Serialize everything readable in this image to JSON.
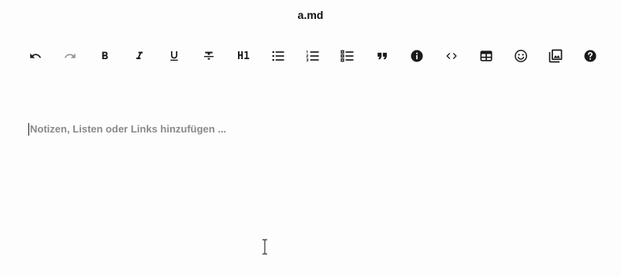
{
  "document": {
    "title": "a.md"
  },
  "toolbar": {
    "items": [
      {
        "name": "undo",
        "icon": "undo-icon",
        "enabled": true
      },
      {
        "name": "redo",
        "icon": "redo-icon",
        "enabled": false
      },
      {
        "name": "bold",
        "icon": "bold-icon",
        "enabled": true
      },
      {
        "name": "italic",
        "icon": "italic-icon",
        "enabled": true
      },
      {
        "name": "underline",
        "icon": "underline-icon",
        "enabled": true
      },
      {
        "name": "strikethrough",
        "icon": "strikethrough-icon",
        "enabled": true
      },
      {
        "name": "heading",
        "icon": "heading-icon",
        "label": "H1",
        "enabled": true
      },
      {
        "name": "bullet-list",
        "icon": "bullet-list-icon",
        "enabled": true
      },
      {
        "name": "ordered-list",
        "icon": "ordered-list-icon",
        "enabled": true
      },
      {
        "name": "checklist",
        "icon": "checklist-icon",
        "enabled": true
      },
      {
        "name": "blockquote",
        "icon": "quote-icon",
        "enabled": true
      },
      {
        "name": "info",
        "icon": "info-icon",
        "enabled": true
      },
      {
        "name": "code",
        "icon": "code-icon",
        "enabled": true
      },
      {
        "name": "table",
        "icon": "table-icon",
        "enabled": true
      },
      {
        "name": "emoji",
        "icon": "emoji-icon",
        "enabled": true
      },
      {
        "name": "image",
        "icon": "image-icon",
        "enabled": true
      },
      {
        "name": "help",
        "icon": "help-icon",
        "enabled": true
      }
    ]
  },
  "editor": {
    "placeholder": "Notizen, Listen oder Links hinzufügen ..."
  },
  "colors": {
    "icon": "#1a1a1a",
    "icon_disabled": "#9a9a9a",
    "placeholder": "#8a8a8a",
    "background": "#fdfdfd"
  }
}
